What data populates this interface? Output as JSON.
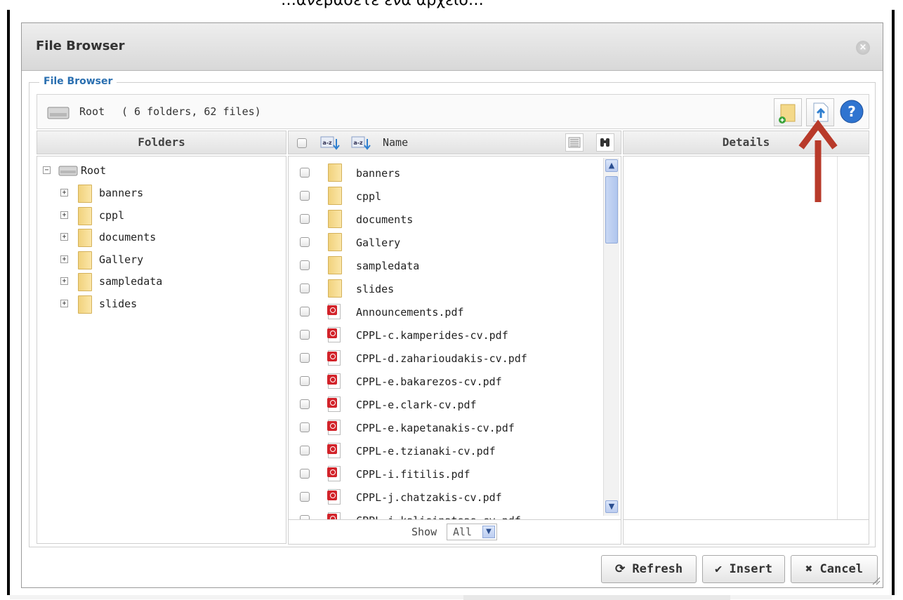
{
  "top_caption": "…ανεβάσετε ένα αρχείο…",
  "dialog": {
    "title": "File Browser",
    "close_symbol": "×"
  },
  "fieldset_legend": "File Browser",
  "pathbar": {
    "root_label": "Root",
    "counts": "( 6 folders, 62 files)"
  },
  "toolbar_icons": [
    "new-folder-icon",
    "upload-icon",
    "help-icon"
  ],
  "help_symbol": "?",
  "columns": {
    "folders": "Folders",
    "name": "Name",
    "details": "Details"
  },
  "tree": {
    "root": "Root",
    "expander_collapsed": "+",
    "expander_expanded": "−",
    "folders": [
      "banners",
      "cppl",
      "documents",
      "Gallery",
      "sampledata",
      "slides"
    ]
  },
  "files": [
    {
      "name": "banners",
      "type": "folder"
    },
    {
      "name": "cppl",
      "type": "folder"
    },
    {
      "name": "documents",
      "type": "folder"
    },
    {
      "name": "Gallery",
      "type": "folder"
    },
    {
      "name": "sampledata",
      "type": "folder"
    },
    {
      "name": "slides",
      "type": "folder"
    },
    {
      "name": "Announcements.pdf",
      "type": "pdf"
    },
    {
      "name": "CPPL-c.kamperides-cv.pdf",
      "type": "pdf"
    },
    {
      "name": "CPPL-d.zaharioudakis-cv.pdf",
      "type": "pdf"
    },
    {
      "name": "CPPL-e.bakarezos-cv.pdf",
      "type": "pdf"
    },
    {
      "name": "CPPL-e.clark-cv.pdf",
      "type": "pdf"
    },
    {
      "name": "CPPL-e.kapetanakis-cv.pdf",
      "type": "pdf"
    },
    {
      "name": "CPPL-e.tzianaki-cv.pdf",
      "type": "pdf"
    },
    {
      "name": "CPPL-i.fitilis.pdf",
      "type": "pdf"
    },
    {
      "name": "CPPL-j.chatzakis-cv.pdf",
      "type": "pdf"
    },
    {
      "name": "CPPL-j.kalisinatsas-cv.pdf",
      "type": "pdf"
    }
  ],
  "show": {
    "label": "Show",
    "value": "All"
  },
  "buttons": {
    "refresh": "⟳ Refresh",
    "insert": "✔ Insert",
    "cancel": "✖ Cancel"
  },
  "colors": {
    "legend": "#2a6fb0",
    "annotation_arrow": "#b83a2a"
  }
}
